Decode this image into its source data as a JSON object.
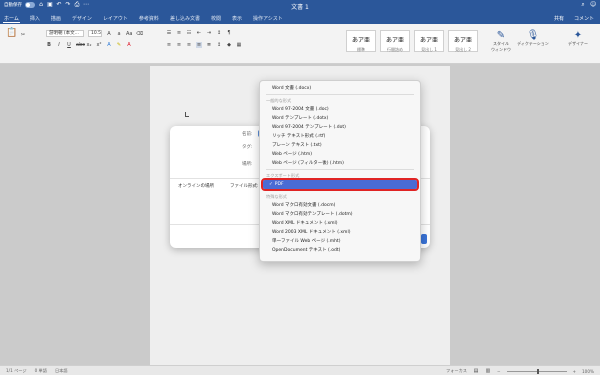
{
  "titlebar": {
    "autosave_label": "自動保存",
    "autosave_state": "オフ",
    "title": "文書 1",
    "share_label": "共有",
    "comment_label": "コメント"
  },
  "tabs": {
    "items": [
      "ホーム",
      "挿入",
      "描画",
      "デザイン",
      "レイアウト",
      "参考資料",
      "差し込み文書",
      "校閲",
      "表示",
      "操作アシスト"
    ],
    "active_index": 0,
    "share": "共有",
    "comments": "コメント"
  },
  "ribbon": {
    "font_name": "游明朝 (本文...",
    "font_size": "10.5",
    "styles": [
      {
        "sample": "あア亜",
        "name": "標準"
      },
      {
        "sample": "あア亜",
        "name": "行間詰め"
      },
      {
        "sample": "あア亜",
        "name": "見出し 1"
      },
      {
        "sample": "あア亜",
        "name": "見出し 2"
      }
    ],
    "styles_pane": "スタイル\nウィンドウ",
    "dictation": "ディクテーション",
    "designer": "デザイナー"
  },
  "dialog": {
    "name_label": "名前:",
    "tags_label": "タグ:",
    "location_label": "場所:",
    "online_locations": "オンラインの場所",
    "file_format_label": "ファイル形式:"
  },
  "format_menu": {
    "sections": [
      {
        "header": "",
        "items": [
          "Word 文書 (.docx)"
        ]
      },
      {
        "header": "一般的な形式",
        "items": [
          "Word 97-2004 文書 (.doc)",
          "Word テンプレート (.dotx)",
          "Word 97-2004 テンプレート (.dot)",
          "リッチ テキスト形式 (.rtf)",
          "プレーン テキスト (.txt)",
          "Web ページ (.htm)",
          "Web ページ (フィルター後) (.htm)"
        ]
      },
      {
        "header": "エクスポート形式",
        "items": [
          "PDF"
        ]
      },
      {
        "header": "特殊な形式",
        "items": [
          "Word マクロ有効文書 (.docm)",
          "Word マクロ有効テンプレート (.dotm)",
          "Word XML ドキュメント (.xml)",
          "Word 2003 XML ドキュメント (.xml)",
          "単一ファイル Web ページ (.mht)",
          "OpenDocument テキスト (.odt)"
        ]
      }
    ],
    "selected": "PDF"
  },
  "statusbar": {
    "page": "1/1 ページ",
    "words": "0 単語",
    "language": "日本語",
    "focus": "フォーカス",
    "zoom": "100%"
  },
  "colors": {
    "accent": "#2b579a",
    "selection": "#4a6bd4",
    "highlight_ring": "#e02424"
  }
}
